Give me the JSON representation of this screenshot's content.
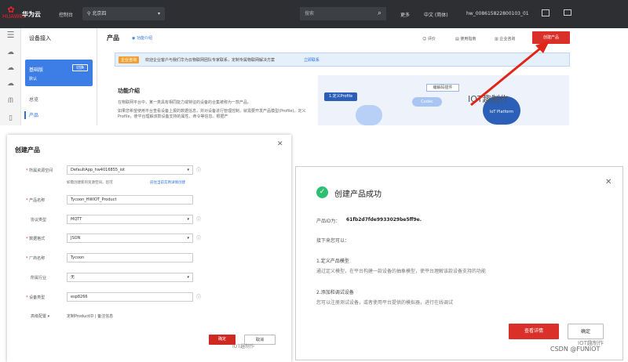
{
  "topbar": {
    "logo_text": "HUAWEI",
    "brand": "华为云",
    "console": "控制台",
    "region": "北京四",
    "search_placeholder": "搜索",
    "nav_more": "更多",
    "nav_lang": "中文 (简体)",
    "account": "hw_008615822800103_01"
  },
  "sidebar": {
    "title": "设备接入",
    "edition": "基础版",
    "edition_default": "默认",
    "switch_label": "切换",
    "items": [
      {
        "label": "总览"
      },
      {
        "label": "产品"
      }
    ]
  },
  "main": {
    "title": "产品",
    "func_link": "功能介绍",
    "actions": {
      "eval": "评价",
      "guide": "使用指南",
      "consult": "企业咨询",
      "create": "创建产品"
    },
    "banner": {
      "tag": "企业咨询",
      "text": "欢迎企业客户与我们华为云物联网团队专家联系，定制专属物联网解决方案",
      "link": "立即联系"
    },
    "intro": {
      "title": "功能介绍",
      "p1": "在物联网平台中，某一类具有相同能力或特征的设备的合集被称为一款产品。",
      "p2": "如果您希望使用平台查看设备上报的数据信息，并对设备进行管理控制，就需要开发产品模型(Profile)。定义Profile，使平台理解该款设备支持的属性、命令等信息。根据产"
    },
    "diagram": {
      "profile": "1.定义Profile",
      "edit": "编解码插件",
      "codec": "Codec",
      "platform": "IoT Platform"
    }
  },
  "watermark": "IOT趣制作",
  "dialog_create": {
    "title": "创建产品",
    "fields": [
      {
        "label": "所属资源空间",
        "required": true,
        "value": "DefaultApp_hw4016855_iot",
        "type": "select"
      },
      {
        "label": "产品名称",
        "required": true,
        "value": "Tycoon_HWIOT_Product",
        "type": "input"
      },
      {
        "label": "协议类型",
        "required": false,
        "value": "MQTT",
        "type": "select"
      },
      {
        "label": "数据格式",
        "required": true,
        "value": "JSON",
        "type": "select"
      },
      {
        "label": "厂商名称",
        "required": true,
        "value": "Tycoon",
        "type": "input"
      },
      {
        "label": "所属行业",
        "required": false,
        "value": "无",
        "type": "select"
      },
      {
        "label": "设备类型",
        "required": true,
        "value": "esp8266",
        "type": "input"
      }
    ],
    "hint": "如需创建新的资源空间，您可",
    "hint_link": "前往当前实例详情创建",
    "advanced": "高级配置",
    "advanced_extra": "定制ProductID | 备注信息",
    "ok": "确定",
    "cancel": "取消"
  },
  "dialog_success": {
    "title": "创建产品成功",
    "pid_label": "产品ID为：",
    "pid_value": "61fb2d7fde9933029be5ff9e.",
    "next": "接下来您可以：",
    "steps": [
      {
        "title": "1.定义产品模型",
        "desc": "通过定义模型，在平台构建一款设备的抽象模型，使平台理解该款设备支持的功能"
      },
      {
        "title": "2.添加和调试设备",
        "desc": "您可以注册测试设备，或者使用平台提供的模拟器，进行在线调试"
      }
    ],
    "view": "查看详情",
    "confirm": "确定"
  },
  "footer": {
    "csdn": "CSDN @FUNIOT"
  }
}
